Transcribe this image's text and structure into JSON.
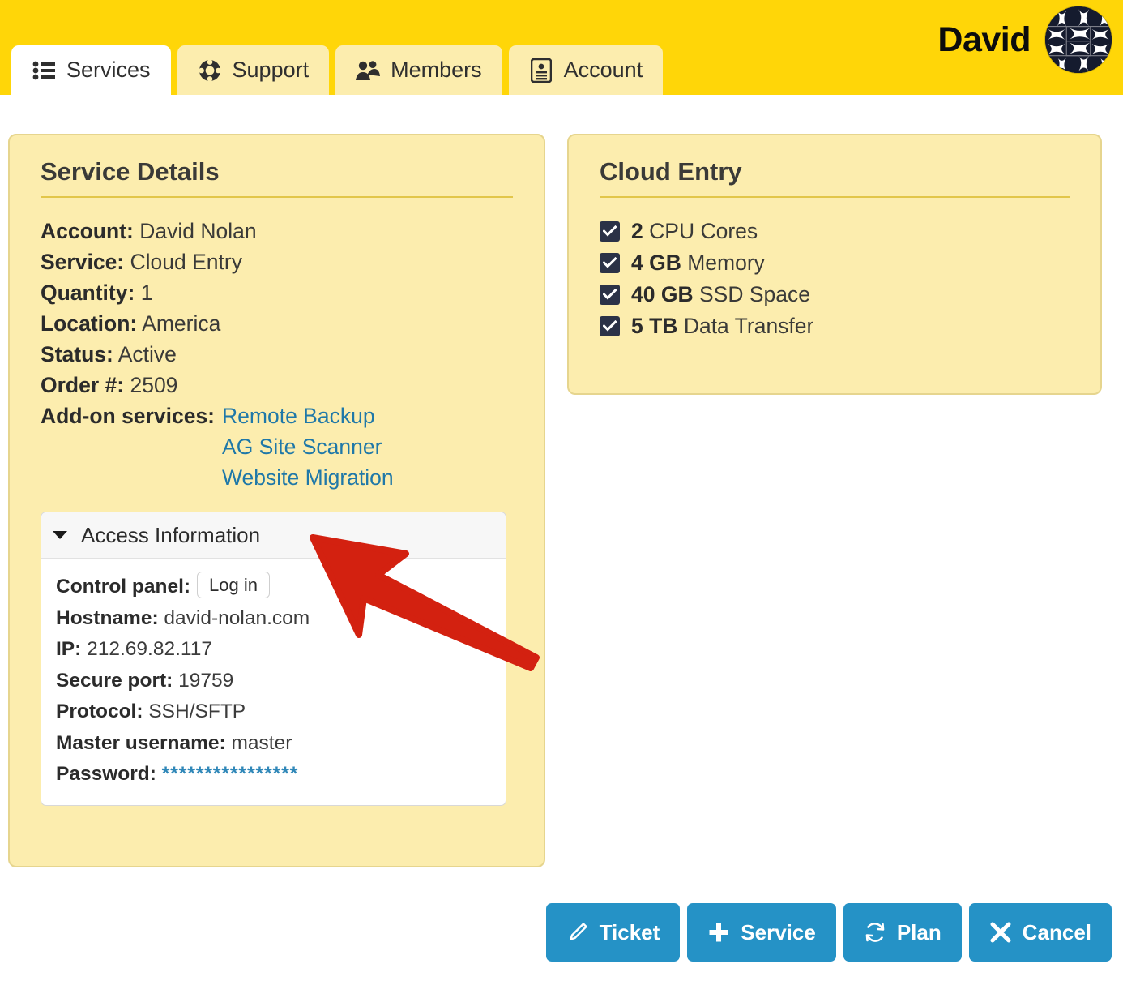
{
  "header": {
    "user_name": "David",
    "avatar_alt": "identicon-avatar",
    "background_color": "#FFD608"
  },
  "tabs": [
    {
      "label": "Services",
      "icon": "list-icon",
      "active": true
    },
    {
      "label": "Support",
      "icon": "lifering-icon",
      "active": false
    },
    {
      "label": "Members",
      "icon": "people-icon",
      "active": false
    },
    {
      "label": "Account",
      "icon": "id-card-icon",
      "active": false
    }
  ],
  "service_details": {
    "title": "Service Details",
    "fields": [
      {
        "label": "Account:",
        "value": "David Nolan"
      },
      {
        "label": "Service:",
        "value": "Cloud Entry"
      },
      {
        "label": "Quantity:",
        "value": "1"
      },
      {
        "label": "Location:",
        "value": "America"
      },
      {
        "label": "Status:",
        "value": "Active"
      },
      {
        "label": "Order #:",
        "value": "2509"
      }
    ],
    "addons": {
      "label": "Add-on services:",
      "links": [
        "Remote Backup",
        "AG Site Scanner",
        "Website Migration"
      ],
      "link_color": "#1f78a8"
    }
  },
  "access_information": {
    "title": "Access Information",
    "expanded": true,
    "caret_icon": "caret-down-icon",
    "control_panel_label": "Control panel:",
    "login_button_label": "Log in",
    "rows": [
      {
        "label": "Hostname:",
        "value": "david-nolan.com"
      },
      {
        "label": "IP:",
        "value": "212.69.82.117"
      },
      {
        "label": "Secure port:",
        "value": "19759"
      },
      {
        "label": "Protocol:",
        "value": "SSH/SFTP"
      },
      {
        "label": "Master username:",
        "value": "master"
      }
    ],
    "password_label": "Password:",
    "password_masked": "****************"
  },
  "cloud_entry": {
    "title": "Cloud Entry",
    "specs": [
      {
        "amount": "2",
        "name": "CPU Cores"
      },
      {
        "amount": "4 GB",
        "name": "Memory"
      },
      {
        "amount": "40 GB",
        "name": "SSD Space"
      },
      {
        "amount": "5 TB",
        "name": "Data Transfer"
      }
    ]
  },
  "actions": [
    {
      "label": "Ticket",
      "icon": "pencil-icon"
    },
    {
      "label": "Service",
      "icon": "plus-icon"
    },
    {
      "label": "Plan",
      "icon": "refresh-icon"
    },
    {
      "label": "Cancel",
      "icon": "close-x-icon"
    }
  ],
  "annotation": {
    "type": "red-arrow",
    "color": "#D32110",
    "points_to": "Access Information"
  },
  "colors": {
    "header_yellow": "#FFD608",
    "panel_cream": "#FCEDAE",
    "panel_border": "#E6D58E",
    "rule_gold": "#E2C64A",
    "button_blue": "#2592C6",
    "link_blue": "#1f78a8",
    "checkbox_navy": "#2b3247"
  }
}
